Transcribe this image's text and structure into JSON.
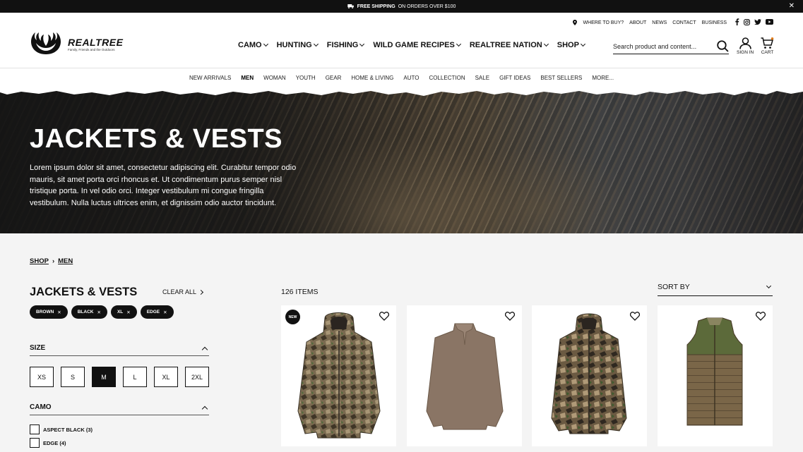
{
  "topbar": {
    "shipping_bold": "FREE SHIPPING",
    "shipping_rest": "ON ORDERS OVER $100",
    "close": "✕"
  },
  "logo": {
    "brand": "REALTREE",
    "tagline": "Family, Friends and the Outdoors"
  },
  "util_links": [
    "WHERE TO BUY?",
    "ABOUT",
    "NEWS",
    "CONTACT",
    "BUSINESS"
  ],
  "main_nav": [
    "CAMO",
    "HUNTING",
    "FISHING",
    "WILD GAME RECIPES",
    "REALTREE NATION",
    "SHOP"
  ],
  "search": {
    "placeholder": "Search product and content..."
  },
  "account": {
    "label": "SIGN IN"
  },
  "cart": {
    "label": "CART"
  },
  "sub_nav": [
    "NEW ARRIVALS",
    "MEN",
    "WOMAN",
    "YOUTH",
    "GEAR",
    "HOME & LIVING",
    "AUTO",
    "COLLECTION",
    "SALE",
    "GIFT IDEAS",
    "BEST SELLERS",
    "MORE..."
  ],
  "hero": {
    "title": "JACKETS & VESTS",
    "body": "Lorem ipsum dolor sit amet, consectetur adipiscing elit. Curabitur tempor odio mauris, sit amet porta orci rhoncus et. Ut condimentum purus semper nisl tristique porta. In vel odio orci. Integer vestibulum mi congue fringilla vestibulum. Nulla luctus ultrices enim, et dignissim odio auctor tincidunt."
  },
  "breadcrumb": {
    "shop": "SHOP",
    "sep": "›",
    "men": "MEN"
  },
  "filters": {
    "title": "JACKETS & VESTS",
    "clear_all": "CLEAR ALL",
    "chips": [
      "BROWN",
      "BLACK",
      "XL",
      "EDGE"
    ],
    "size": {
      "title": "SIZE",
      "options": [
        "XS",
        "S",
        "M",
        "L",
        "XL",
        "2XL"
      ],
      "selected": "M"
    },
    "camo": {
      "title": "CAMO",
      "options": [
        "ASPECT BLACK (3)",
        "EDGE (4)"
      ]
    }
  },
  "results": {
    "count": "126 ITEMS",
    "sort_label": "SORT BY"
  },
  "products": [
    {
      "badge": "NEW",
      "name": "camo-hooded-jacket"
    },
    {
      "badge": "",
      "name": "brown-quarter-zip-pullover"
    },
    {
      "badge": "",
      "name": "camo-parka-jacket"
    },
    {
      "badge": "",
      "name": "green-quilted-vest"
    }
  ],
  "colors": {
    "black": "#111111",
    "page_bg": "#f4f4f4",
    "camo_brown": "#6b5a42",
    "pullover": "#8a7565",
    "vest_green": "#5c6a3a",
    "vest_brown": "#7a6648"
  }
}
